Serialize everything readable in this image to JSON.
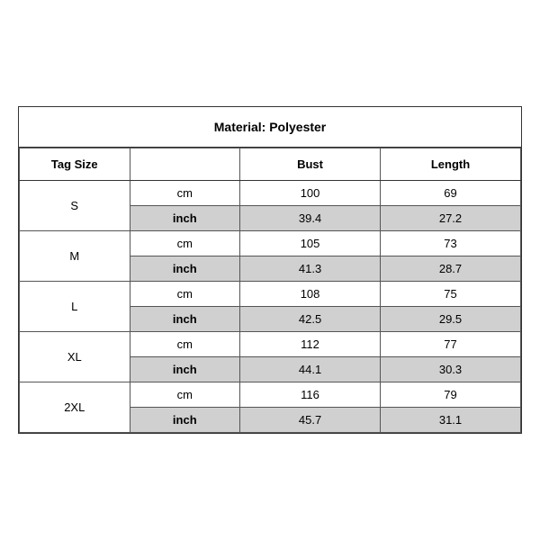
{
  "title": "Material: Polyester",
  "headers": {
    "tag_size": "Tag Size",
    "bust": "Bust",
    "length": "Length"
  },
  "sizes": [
    {
      "label": "S",
      "cm": {
        "bust": "100",
        "length": "69"
      },
      "inch": {
        "bust": "39.4",
        "length": "27.2"
      }
    },
    {
      "label": "M",
      "cm": {
        "bust": "105",
        "length": "73"
      },
      "inch": {
        "bust": "41.3",
        "length": "28.7"
      }
    },
    {
      "label": "L",
      "cm": {
        "bust": "108",
        "length": "75"
      },
      "inch": {
        "bust": "42.5",
        "length": "29.5"
      }
    },
    {
      "label": "XL",
      "cm": {
        "bust": "112",
        "length": "77"
      },
      "inch": {
        "bust": "44.1",
        "length": "30.3"
      }
    },
    {
      "label": "2XL",
      "cm": {
        "bust": "116",
        "length": "79"
      },
      "inch": {
        "bust": "45.7",
        "length": "31.1"
      }
    }
  ],
  "units": {
    "cm": "cm",
    "inch": "inch"
  }
}
